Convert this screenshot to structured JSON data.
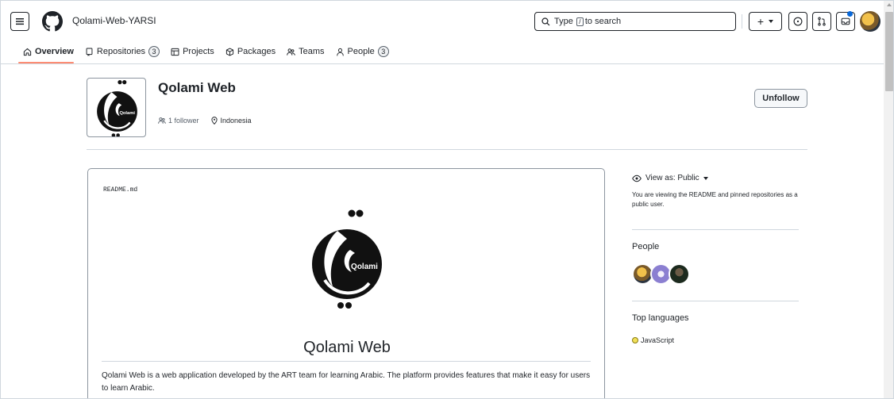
{
  "header": {
    "org_name": "Qolami-Web-YARSI",
    "search_prefix": "Type",
    "search_key": "/",
    "search_suffix": "to search",
    "create_label": "+"
  },
  "tabs": [
    {
      "label": "Overview",
      "selected": true
    },
    {
      "label": "Repositories",
      "count": "3"
    },
    {
      "label": "Projects"
    },
    {
      "label": "Packages"
    },
    {
      "label": "Teams"
    },
    {
      "label": "People",
      "count": "3"
    }
  ],
  "org": {
    "title": "Qolami Web",
    "followers": "1 follower",
    "location": "Indonesia",
    "unfollow_label": "Unfollow",
    "logo_text": "Qolami"
  },
  "readme": {
    "filename": "README.md",
    "title": "Qolami Web",
    "description": "Qolami Web is a web application developed by the ART team for learning Arabic. The platform provides features that make it easy for users to learn Arabic."
  },
  "sidebar": {
    "view_as": "View as: Public",
    "view_note": "You are viewing the README and pinned repositories as a public user.",
    "people_heading": "People",
    "languages_heading": "Top languages",
    "languages": [
      {
        "name": "JavaScript",
        "color": "#f1e05a"
      }
    ]
  },
  "colors": {
    "accent_underline": "#fd8c73",
    "notification": "#0969da"
  }
}
